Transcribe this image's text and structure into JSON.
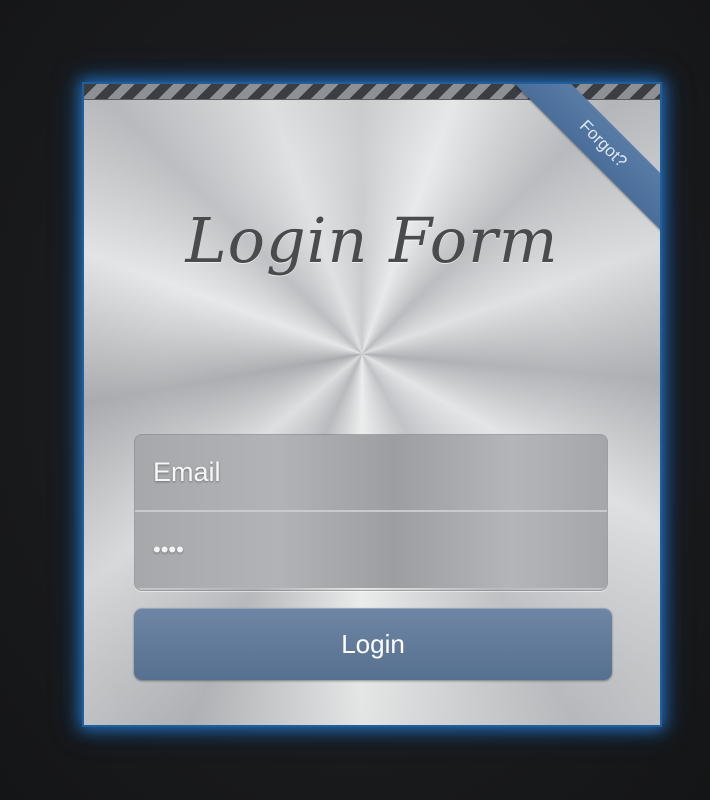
{
  "form": {
    "title": "Login Form",
    "forgot_label": "Forgot?",
    "email_placeholder": "Email",
    "password_value": "••••",
    "login_label": "Login"
  },
  "colors": {
    "background": "#1b1c1e",
    "glow": "#2b86dc",
    "button": "#5f7897",
    "ribbon": "#4f739e"
  }
}
